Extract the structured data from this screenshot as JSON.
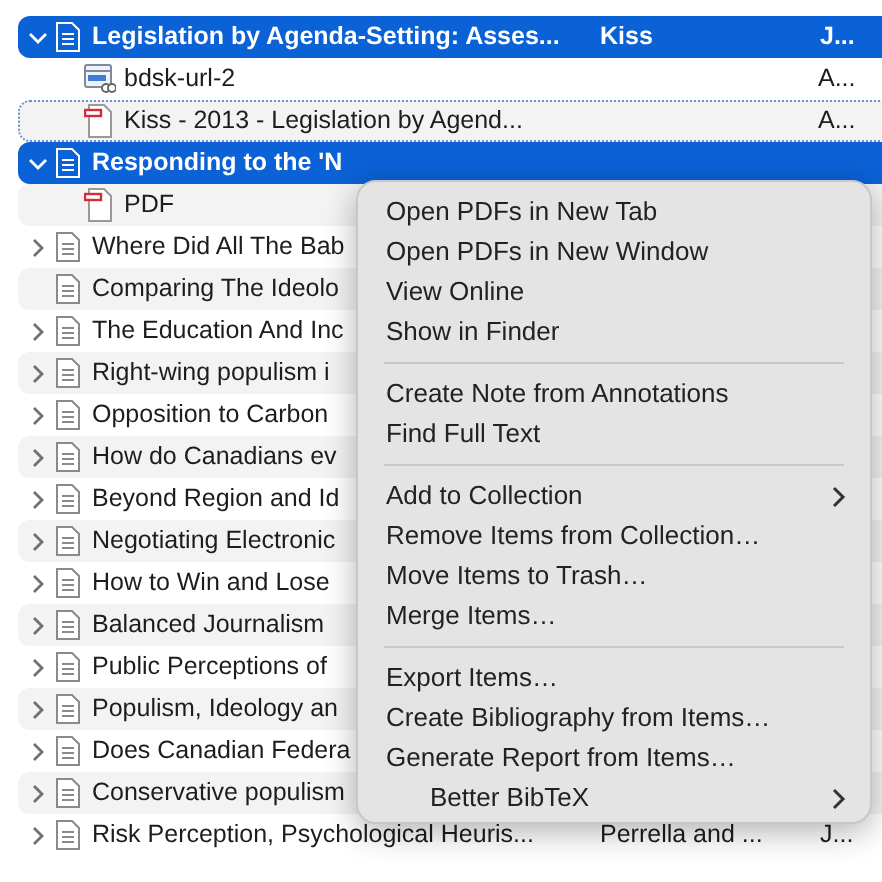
{
  "items": [
    {
      "kind": "item",
      "expandable": true,
      "expanded": true,
      "selected": true,
      "focused": false,
      "title": "Legislation by Agenda-Setting: Asses...",
      "creator": "Kiss",
      "date": "J..."
    },
    {
      "kind": "link",
      "selected": false,
      "focused": false,
      "title": "bdsk-url-2",
      "date": "A..."
    },
    {
      "kind": "pdf",
      "selected": false,
      "focused": true,
      "title": "Kiss - 2013 - Legislation by Agend...",
      "date": "A..."
    },
    {
      "kind": "item",
      "expandable": true,
      "expanded": true,
      "selected": true,
      "focused": false,
      "title": "Responding to the 'N"
    },
    {
      "kind": "pdf",
      "selected": false,
      "focused": false,
      "title": "PDF"
    },
    {
      "kind": "item",
      "expandable": true,
      "expanded": false,
      "selected": false,
      "focused": false,
      "title": "Where Did All The Bab"
    },
    {
      "kind": "item",
      "expandable": false,
      "selected": false,
      "focused": false,
      "title": "Comparing The Ideolo"
    },
    {
      "kind": "item",
      "expandable": true,
      "expanded": false,
      "selected": false,
      "focused": false,
      "title": "The Education And Inc"
    },
    {
      "kind": "item",
      "expandable": true,
      "expanded": false,
      "selected": false,
      "focused": false,
      "title": "Right-wing populism i"
    },
    {
      "kind": "item",
      "expandable": true,
      "expanded": false,
      "selected": false,
      "focused": false,
      "title": "Opposition to Carbon"
    },
    {
      "kind": "item",
      "expandable": true,
      "expanded": false,
      "selected": false,
      "focused": false,
      "title": "How do Canadians ev"
    },
    {
      "kind": "item",
      "expandable": true,
      "expanded": false,
      "selected": false,
      "focused": false,
      "title": "Beyond Region and Id"
    },
    {
      "kind": "item",
      "expandable": true,
      "expanded": false,
      "selected": false,
      "focused": false,
      "title": "Negotiating Electronic"
    },
    {
      "kind": "item",
      "expandable": true,
      "expanded": false,
      "selected": false,
      "focused": false,
      "title": "How to Win and Lose"
    },
    {
      "kind": "item",
      "expandable": true,
      "expanded": false,
      "selected": false,
      "focused": false,
      "title": "Balanced Journalism"
    },
    {
      "kind": "item",
      "expandable": true,
      "expanded": false,
      "selected": false,
      "focused": false,
      "title": "Public Perceptions of"
    },
    {
      "kind": "item",
      "expandable": true,
      "expanded": false,
      "selected": false,
      "focused": false,
      "title": "Populism, Ideology an"
    },
    {
      "kind": "item",
      "expandable": true,
      "expanded": false,
      "selected": false,
      "focused": false,
      "title": "Does Canadian Federa"
    },
    {
      "kind": "item",
      "expandable": true,
      "expanded": false,
      "selected": false,
      "focused": false,
      "title": "Conservative populism"
    },
    {
      "kind": "item",
      "expandable": true,
      "expanded": false,
      "selected": false,
      "focused": false,
      "title": "Risk Perception, Psychological Heuris...",
      "creator": "Perrella and ...",
      "date": "J..."
    }
  ],
  "context_menu": [
    {
      "kind": "item",
      "label": "Open PDFs in New Tab"
    },
    {
      "kind": "item",
      "label": "Open PDFs in New Window"
    },
    {
      "kind": "item",
      "label": "View Online"
    },
    {
      "kind": "item",
      "label": "Show in Finder"
    },
    {
      "kind": "separator"
    },
    {
      "kind": "item",
      "label": "Create Note from Annotations"
    },
    {
      "kind": "item",
      "label": "Find Full Text"
    },
    {
      "kind": "separator"
    },
    {
      "kind": "submenu",
      "label": "Add to Collection"
    },
    {
      "kind": "item",
      "label": "Remove Items from Collection…"
    },
    {
      "kind": "item",
      "label": "Move Items to Trash…"
    },
    {
      "kind": "item",
      "label": "Merge Items…"
    },
    {
      "kind": "separator"
    },
    {
      "kind": "item",
      "label": "Export Items…"
    },
    {
      "kind": "item",
      "label": "Create Bibliography from Items…"
    },
    {
      "kind": "item",
      "label": "Generate Report from Items…"
    },
    {
      "kind": "submenu",
      "label": "Better BibTeX",
      "indented": true
    }
  ]
}
